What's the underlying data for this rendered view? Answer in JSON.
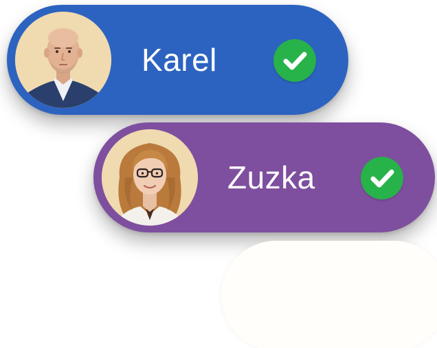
{
  "users": [
    {
      "name": "Karel",
      "status": "checked",
      "pill_color": "#2d63c0",
      "check_color": "#27b24a",
      "avatar_icon": "man-portrait"
    },
    {
      "name": "Zuzka",
      "status": "checked",
      "pill_color": "#7f4f9f",
      "check_color": "#27b24a",
      "avatar_icon": "woman-portrait"
    }
  ],
  "colors": {
    "avatar_bg": "#f0dab0",
    "ghost_pill": "#fffefa"
  },
  "icons": {
    "check": "check-circle-icon"
  }
}
